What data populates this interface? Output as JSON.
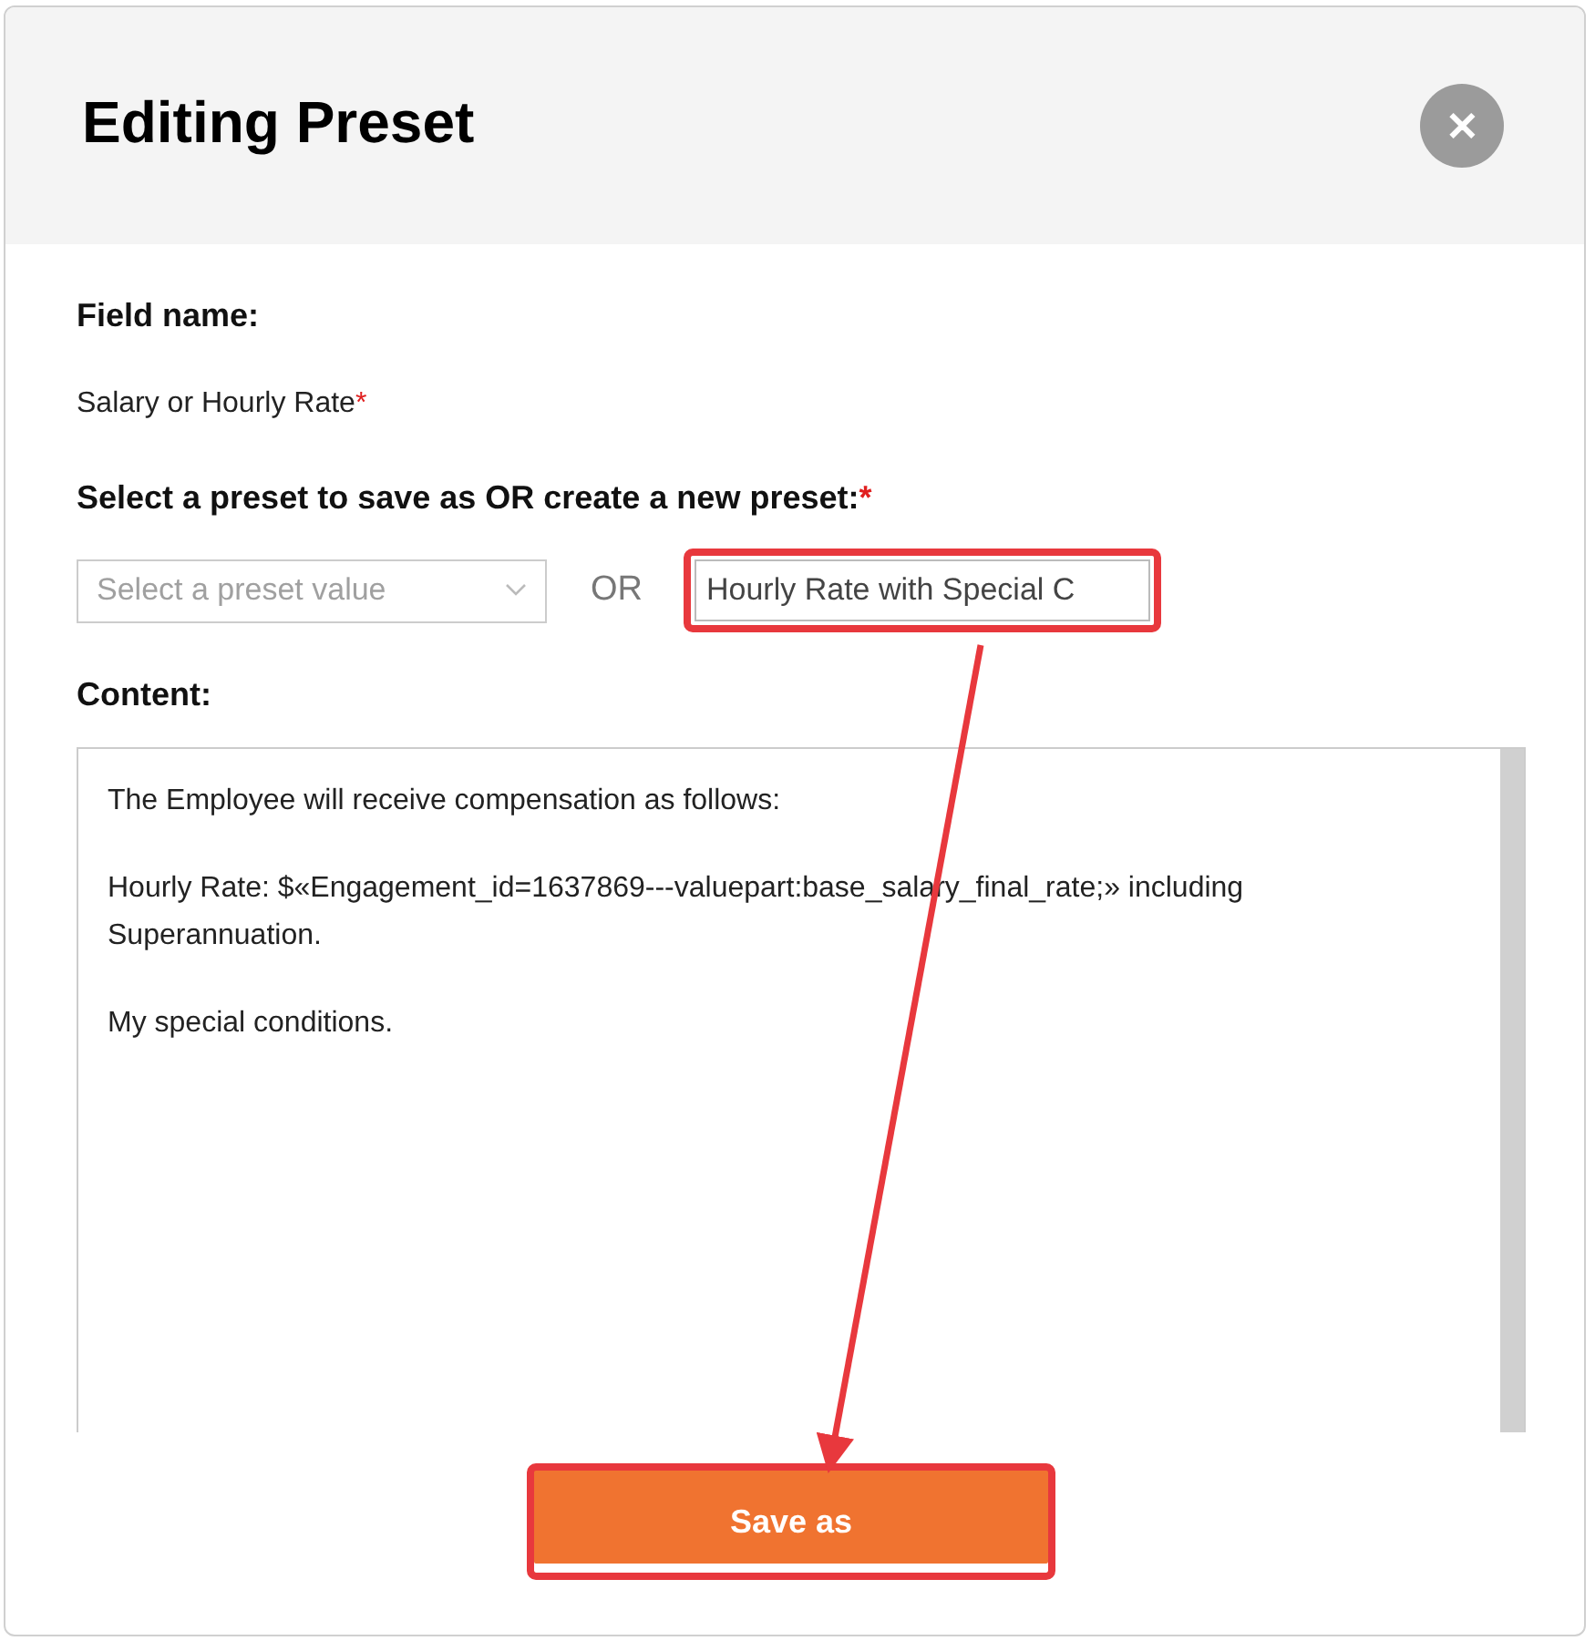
{
  "dialog": {
    "title": "Editing Preset",
    "close_label": "✕"
  },
  "field_name": {
    "label": "Field name:",
    "value": "Salary or Hourly Rate",
    "required": true,
    "required_mark": "*"
  },
  "preset": {
    "label": "Select a preset to save as OR create a new preset:",
    "required": true,
    "required_mark": "*",
    "select_placeholder": "Select a preset value",
    "separator": "OR",
    "new_preset_value": "Hourly Rate with Special C",
    "highlighted": true
  },
  "content": {
    "label": "Content:",
    "paragraphs": [
      "The Employee will receive compensation as follows:",
      "Hourly Rate: $«Engagement_id=1637869---valuepart:base_salary_final_rate;» including Superannuation.",
      "My special conditions."
    ]
  },
  "save_button": {
    "label": "Save as",
    "highlighted": true
  },
  "annotation_arrow": true
}
